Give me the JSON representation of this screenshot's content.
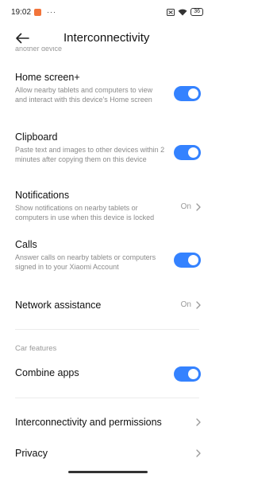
{
  "status_bar": {
    "time": "19:02",
    "dots": "···",
    "battery": "36"
  },
  "header": {
    "title": "Interconnectivity"
  },
  "clipped_text": "another device",
  "settings": [
    {
      "id": "home-screen",
      "title": "Home screen+",
      "desc": "Allow nearby tablets and computers to view and interact with this device's Home screen",
      "control": "toggle",
      "on": true
    },
    {
      "id": "clipboard",
      "title": "Clipboard",
      "desc": "Paste text and images to other devices within 2 minutes after copying them on this device",
      "control": "toggle",
      "on": true
    },
    {
      "id": "notifications",
      "title": "Notifications",
      "desc": "Show notifications on nearby tablets or computers in use when this device is locked",
      "control": "value",
      "value": "On"
    },
    {
      "id": "calls",
      "title": "Calls",
      "desc": "Answer calls on nearby tablets or computers signed in to your Xiaomi Account",
      "control": "toggle",
      "on": true
    },
    {
      "id": "network-assistance",
      "title": "Network assistance",
      "control": "value",
      "value": "On"
    }
  ],
  "car_section": {
    "header": "Car features"
  },
  "combine_apps": {
    "title": "Combine apps",
    "on": true
  },
  "links": [
    {
      "id": "interconnectivity-permissions",
      "title": "Interconnectivity and permissions"
    },
    {
      "id": "privacy",
      "title": "Privacy"
    }
  ],
  "colors": {
    "accent": "#3482ff",
    "notification": "#f2743a"
  }
}
